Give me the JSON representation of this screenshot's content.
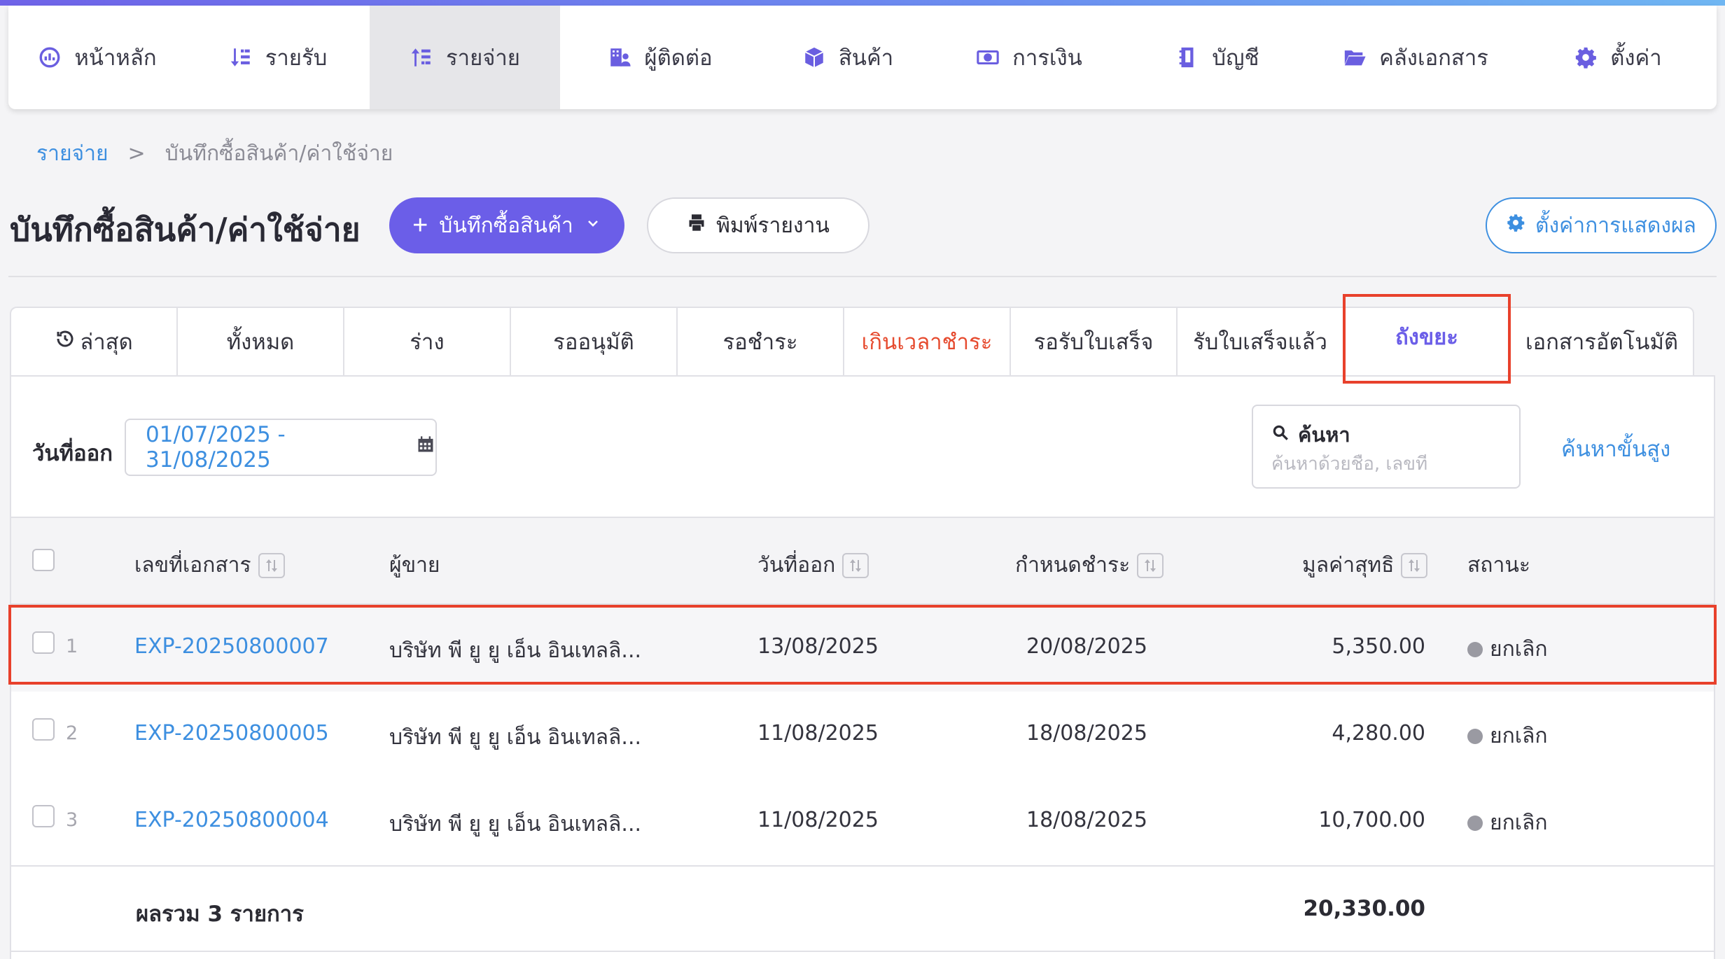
{
  "nav": {
    "items": [
      {
        "label": "หน้าหลัก",
        "icon": "dashboard-gauge-icon"
      },
      {
        "label": "รายรับ",
        "icon": "sort-income-icon"
      },
      {
        "label": "รายจ่าย",
        "icon": "sort-expense-icon",
        "active": true
      },
      {
        "label": "ผู้ติดต่อ",
        "icon": "contacts-building-icon"
      },
      {
        "label": "สินค้า",
        "icon": "box-icon"
      },
      {
        "label": "การเงิน",
        "icon": "money-bill-icon"
      },
      {
        "label": "บัญชี",
        "icon": "ledger-book-icon"
      },
      {
        "label": "คลังเอกสาร",
        "icon": "folder-open-icon"
      },
      {
        "label": "ตั้งค่า",
        "icon": "gear-icon"
      }
    ]
  },
  "breadcrumb": {
    "parent": "รายจ่าย",
    "separator": ">",
    "current": "บันทึกซื้อสินค้า/ค่าใช้จ่าย"
  },
  "header": {
    "title": "บันทึกซื้อสินค้า/ค่าใช้จ่าย",
    "primary_button": "บันทึกซื้อสินค้า",
    "print_button": "พิมพ์รายงาน",
    "display_settings_button": "ตั้งค่าการแสดงผล"
  },
  "tabs": [
    {
      "label": "ล่าสุด"
    },
    {
      "label": "ทั้งหมด"
    },
    {
      "label": "ร่าง"
    },
    {
      "label": "รออนุมัติ"
    },
    {
      "label": "รอชำระ"
    },
    {
      "label": "เกินเวลาชำระ"
    },
    {
      "label": "รอรับใบเสร็จ"
    },
    {
      "label": "รับใบเสร็จแล้ว"
    },
    {
      "label": "ถังขยะ"
    },
    {
      "label": "เอกสารอัตโนมัติ"
    }
  ],
  "filters": {
    "date_label": "วันที่ออก",
    "date_range": "01/07/2025 - 31/08/2025",
    "search_label": "ค้นหา",
    "search_placeholder": "ค้นหาด้วยชื่อ, เลขที่",
    "advanced_search": "ค้นหาขั้นสูง"
  },
  "table": {
    "columns": {
      "doc_no": "เลขที่เอกสาร",
      "vendor": "ผู้ขาย",
      "issue_date": "วันที่ออก",
      "due_date": "กำหนดชำระ",
      "net_amount": "มูลค่าสุทธิ",
      "status": "สถานะ"
    },
    "rows": [
      {
        "num": "1",
        "doc_no": "EXP-20250800007",
        "vendor": "บริษัท พี ยู ยู เอ็น อินเทลลิ...",
        "issue_date": "13/08/2025",
        "due_date": "20/08/2025",
        "net_amount": "5,350.00",
        "status": "ยกเลิก"
      },
      {
        "num": "2",
        "doc_no": "EXP-20250800005",
        "vendor": "บริษัท พี ยู ยู เอ็น อินเทลลิ...",
        "issue_date": "11/08/2025",
        "due_date": "18/08/2025",
        "net_amount": "4,280.00",
        "status": "ยกเลิก"
      },
      {
        "num": "3",
        "doc_no": "EXP-20250800004",
        "vendor": "บริษัท พี ยู ยู เอ็น อินเทลลิ...",
        "issue_date": "11/08/2025",
        "due_date": "18/08/2025",
        "net_amount": "10,700.00",
        "status": "ยกเลิก"
      }
    ],
    "total_label": "ผลรวม 3 รายการ",
    "total_value": "20,330.00"
  },
  "colors": {
    "accent": "#6b5ee8",
    "link": "#3d8fe0",
    "overdue": "#e64a2e",
    "annotation": "#e8412c",
    "status_cancelled": "#9a9aa2"
  }
}
